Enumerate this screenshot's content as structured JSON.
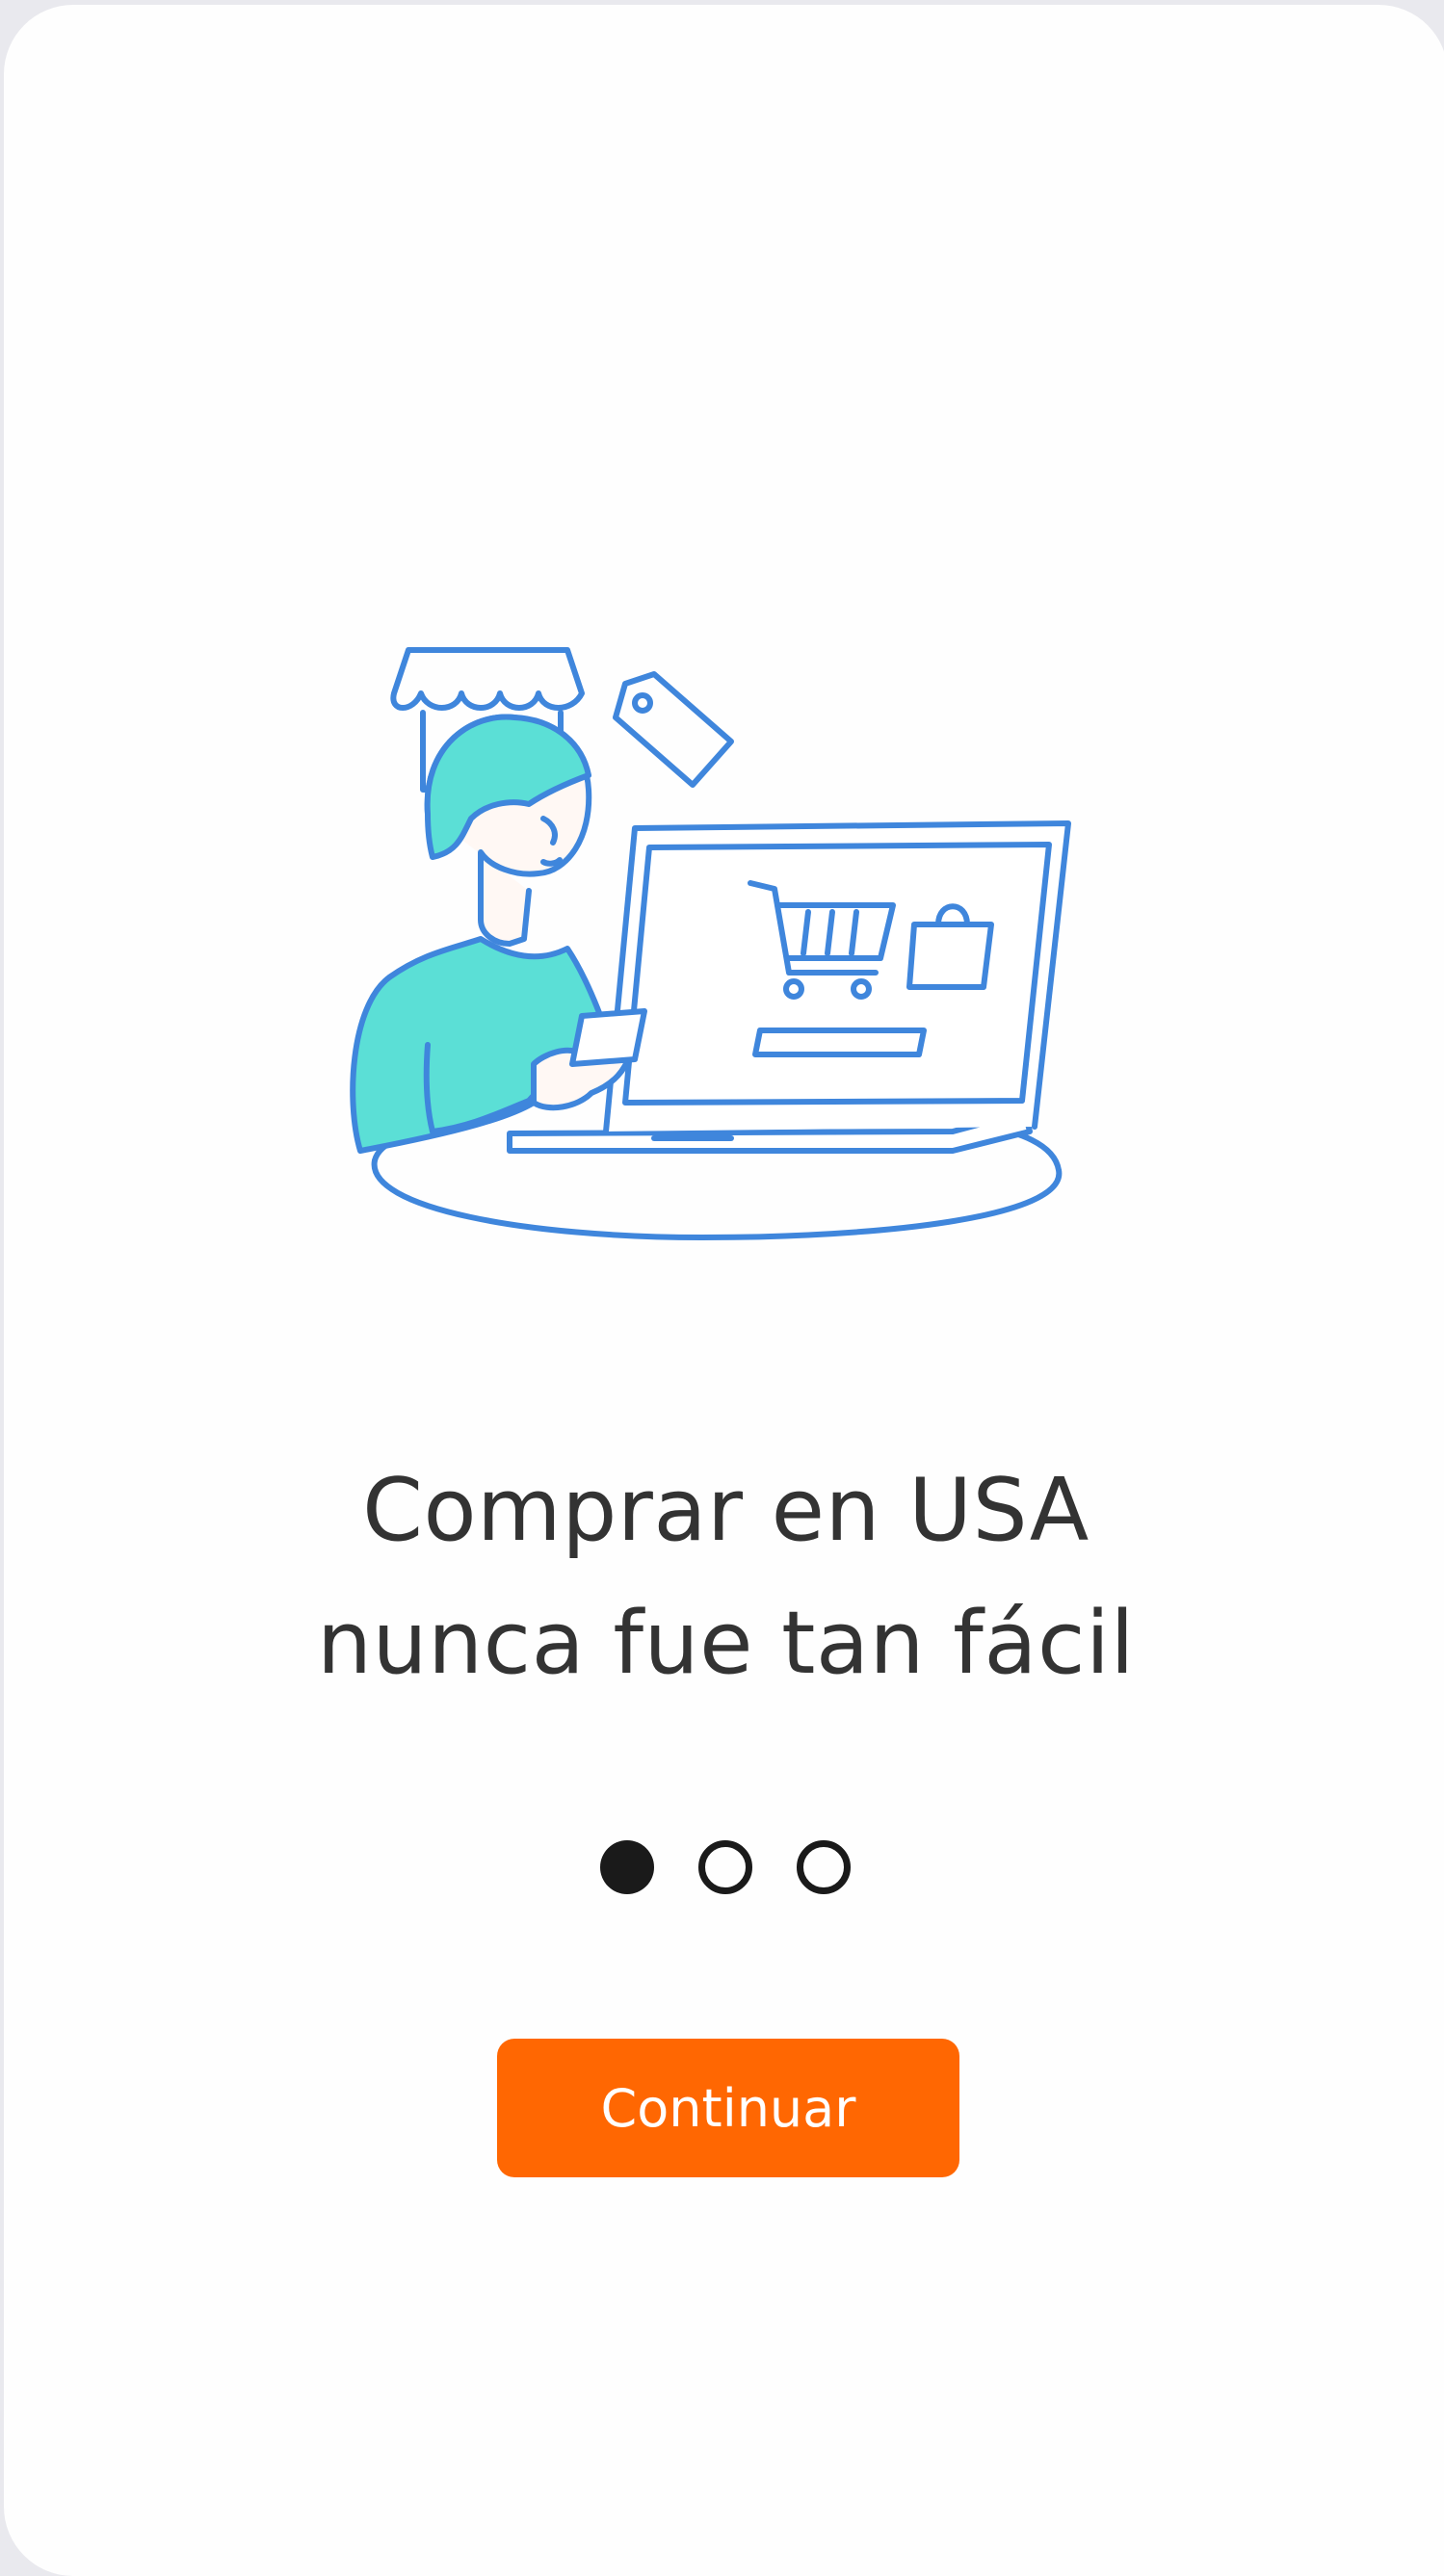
{
  "onboarding": {
    "headline_line1": "Comprar en USA",
    "headline_line2": "nunca fue tan fácil",
    "illustration_icon": "person-shopping-laptop-illustration",
    "pagination": {
      "total": 3,
      "current": 1
    },
    "continue_label": "Continuar"
  },
  "colors": {
    "accent": "#ff6702",
    "illustration_line": "#3f86dc",
    "illustration_fill": "#5bdfd6",
    "text": "#333333",
    "dot": "#1a1a1a"
  }
}
